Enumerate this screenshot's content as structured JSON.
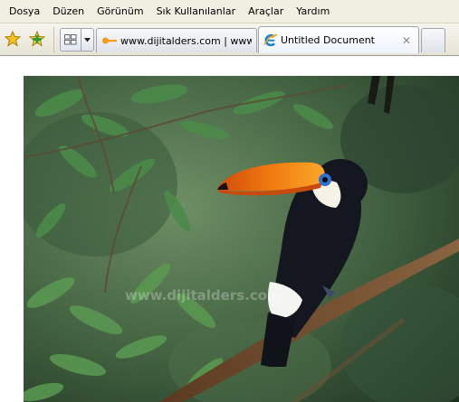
{
  "menu": {
    "items": [
      "Dosya",
      "Düzen",
      "Görünüm",
      "Sık Kullanılanlar",
      "Araçlar",
      "Yardım"
    ]
  },
  "toolbar": {
    "favorites_icon": "star-icon",
    "add_favorite_icon": "add-favorite-icon",
    "quick_tabs_icon": "quick-tabs-icon",
    "tab_list_icon": "chevron-down-icon"
  },
  "tabs": [
    {
      "label": "www.dijitalders.com | www....",
      "icon": "page-icon",
      "active": false
    },
    {
      "label": "Untitled Document",
      "icon": "ie-logo-icon",
      "active": true,
      "close_symbol": "✕"
    }
  ],
  "content": {
    "image_subject": "toucan-photo",
    "watermark": "www.dijitalders.com"
  },
  "colors": {
    "menubar_bg": "#f1efe2",
    "beak_orange": "#f07a10",
    "foliage_green": "#3f6a3a"
  }
}
